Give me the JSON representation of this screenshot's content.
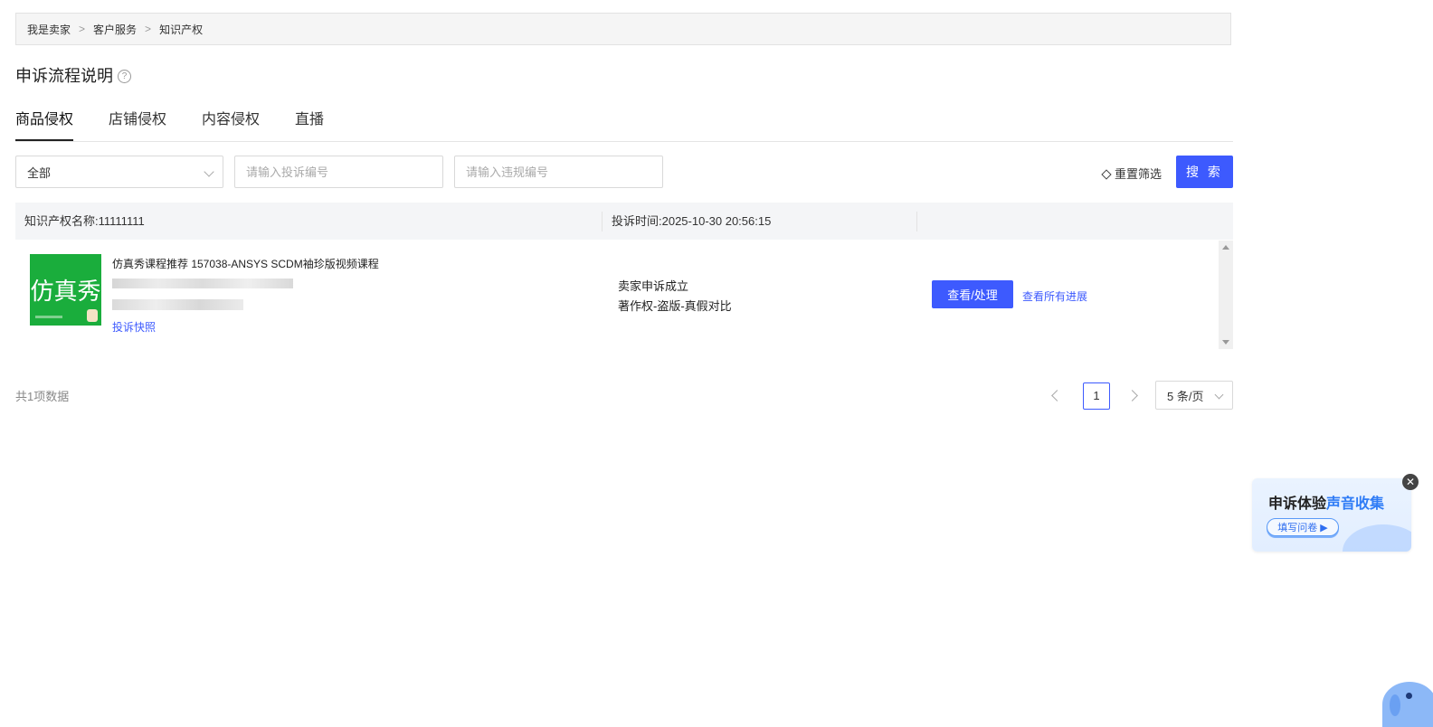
{
  "breadcrumb": {
    "items": [
      "我是卖家",
      "客户服务",
      "知识产权"
    ],
    "separator": ">"
  },
  "page_title": "申诉流程说明",
  "help_icon": "question-circle-icon",
  "tabs": [
    "商品侵权",
    "店铺侵权",
    "内容侵权",
    "直播"
  ],
  "active_tab": "商品侵权",
  "filters": {
    "status_value": "全部",
    "complaint_placeholder": "请输入投诉编号",
    "violation_placeholder": "请输入违规编号",
    "reset_label": "重置筛选",
    "search_label": "搜 索"
  },
  "record": {
    "ip_name": "知识产权名称:11111111",
    "complaint_time": "投诉时间:2025-10-30 20:56:15",
    "thumbnail_text": "仿真秀",
    "product_title": "仿真秀课程推荐 157038-ANSYS SCDM袖珍版视频课程",
    "snapshot_label": "投诉快照",
    "status_line1": "卖家申诉成立",
    "status_line2": "著作权-盗版-真假对比",
    "view_label": "查看/处理",
    "progress_label": "查看所有进展"
  },
  "pagination": {
    "total_text": "共1项数据",
    "current_page": "1",
    "page_size": "5 条/页"
  },
  "promo": {
    "title_part1": "申诉体验",
    "title_part2": "声音收集",
    "button_label": "填写问卷 ▶",
    "close": "✕"
  },
  "colors": {
    "primary": "#3d5afe",
    "thumbnail_green": "#1aad3c"
  }
}
